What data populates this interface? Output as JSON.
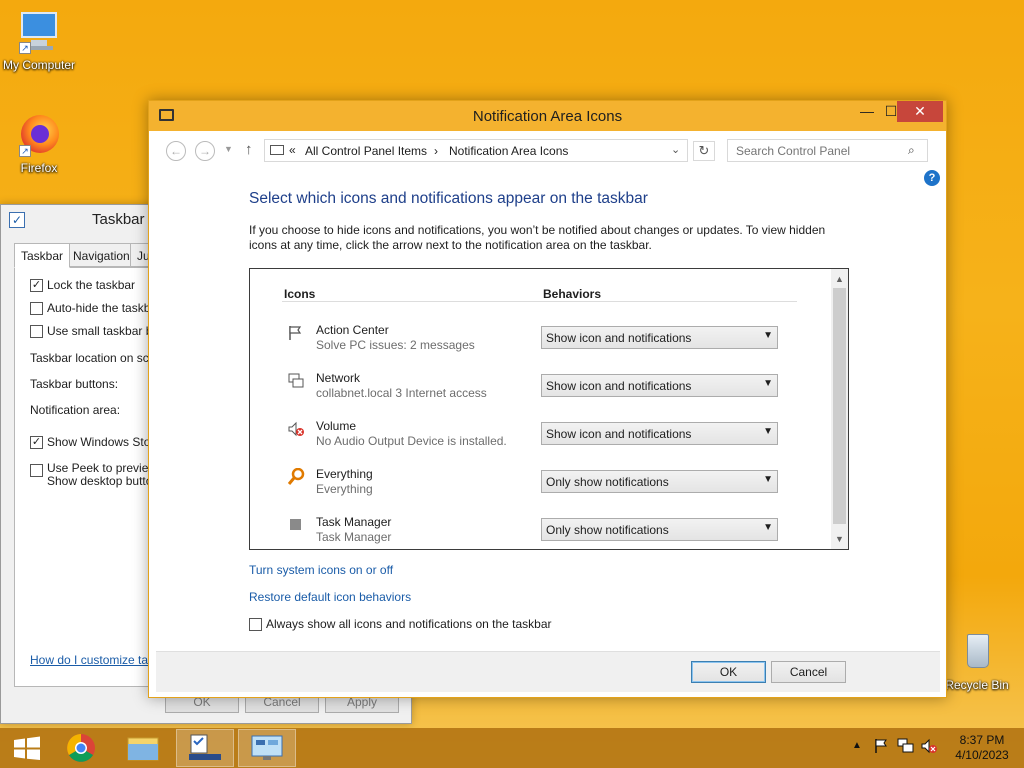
{
  "desktop": {
    "icons": [
      {
        "label": "My Computer"
      },
      {
        "label": "Firefox"
      },
      {
        "label": "Recycle Bin"
      }
    ]
  },
  "taskbar_dialog": {
    "title": "Taskbar",
    "tabs": [
      "Taskbar",
      "Navigation",
      "Ju"
    ],
    "options": [
      {
        "label": "Lock the taskbar",
        "checked": true
      },
      {
        "label": "Auto-hide the taskbar",
        "checked": false
      },
      {
        "label": "Use small taskbar butt",
        "checked": false
      }
    ],
    "fields": [
      "Taskbar location on scree",
      "Taskbar buttons:",
      "Notification area:"
    ],
    "show_store": {
      "label": "Show Windows Store",
      "checked": true
    },
    "peek": {
      "line1": "Use Peek to preview t",
      "line2": "Show desktop button",
      "checked": false
    },
    "help_link": "How do I customize taskb",
    "buttons": [
      "OK",
      "Cancel",
      "Apply"
    ]
  },
  "window": {
    "title": "Notification Area Icons",
    "caption_buttons": {
      "minimize": "—",
      "maximize": "☐",
      "close": "✕"
    },
    "breadcrumb": {
      "root_chevron": "«",
      "items": [
        "All Control Panel Items",
        "Notification Area Icons"
      ],
      "separator": "›"
    },
    "search_placeholder": "Search Control Panel",
    "heading": "Select which icons and notifications appear on the taskbar",
    "description": "If you choose to hide icons and notifications, you won’t be notified about changes or updates. To view hidden icons at any time, click the arrow next to the notification area on the taskbar.",
    "columns": {
      "icons": "Icons",
      "behaviors": "Behaviors"
    },
    "rows": [
      {
        "name": "Action Center",
        "sub": "Solve PC issues: 2 messages",
        "behavior": "Show icon and notifications",
        "icon": "flag-icon"
      },
      {
        "name": "Network",
        "sub": "collabnet.local  3 Internet access",
        "behavior": "Show icon and notifications",
        "icon": "network-icon"
      },
      {
        "name": "Volume",
        "sub": "No Audio Output Device is installed.",
        "behavior": "Show icon and notifications",
        "icon": "volume-muted-icon"
      },
      {
        "name": "Everything",
        "sub": "Everything",
        "behavior": "Only show notifications",
        "icon": "search-magnifier-icon"
      },
      {
        "name": "Task Manager",
        "sub": "Task Manager",
        "behavior": "Only show notifications",
        "icon": "task-manager-icon"
      }
    ],
    "links": [
      "Turn system icons on or off",
      "Restore default icon behaviors"
    ],
    "always_show": {
      "label": "Always show all icons and notifications on the taskbar",
      "checked": false
    },
    "buttons": {
      "ok": "OK",
      "cancel": "Cancel"
    }
  },
  "system_tray": {
    "time": "8:37 PM",
    "date": "4/10/2023"
  },
  "colors": {
    "desktop": "#f4a90e",
    "title_bar": "#f4b22f",
    "close": "#c7463b",
    "link": "#1a5ca8",
    "heading": "#1e3f8a"
  }
}
